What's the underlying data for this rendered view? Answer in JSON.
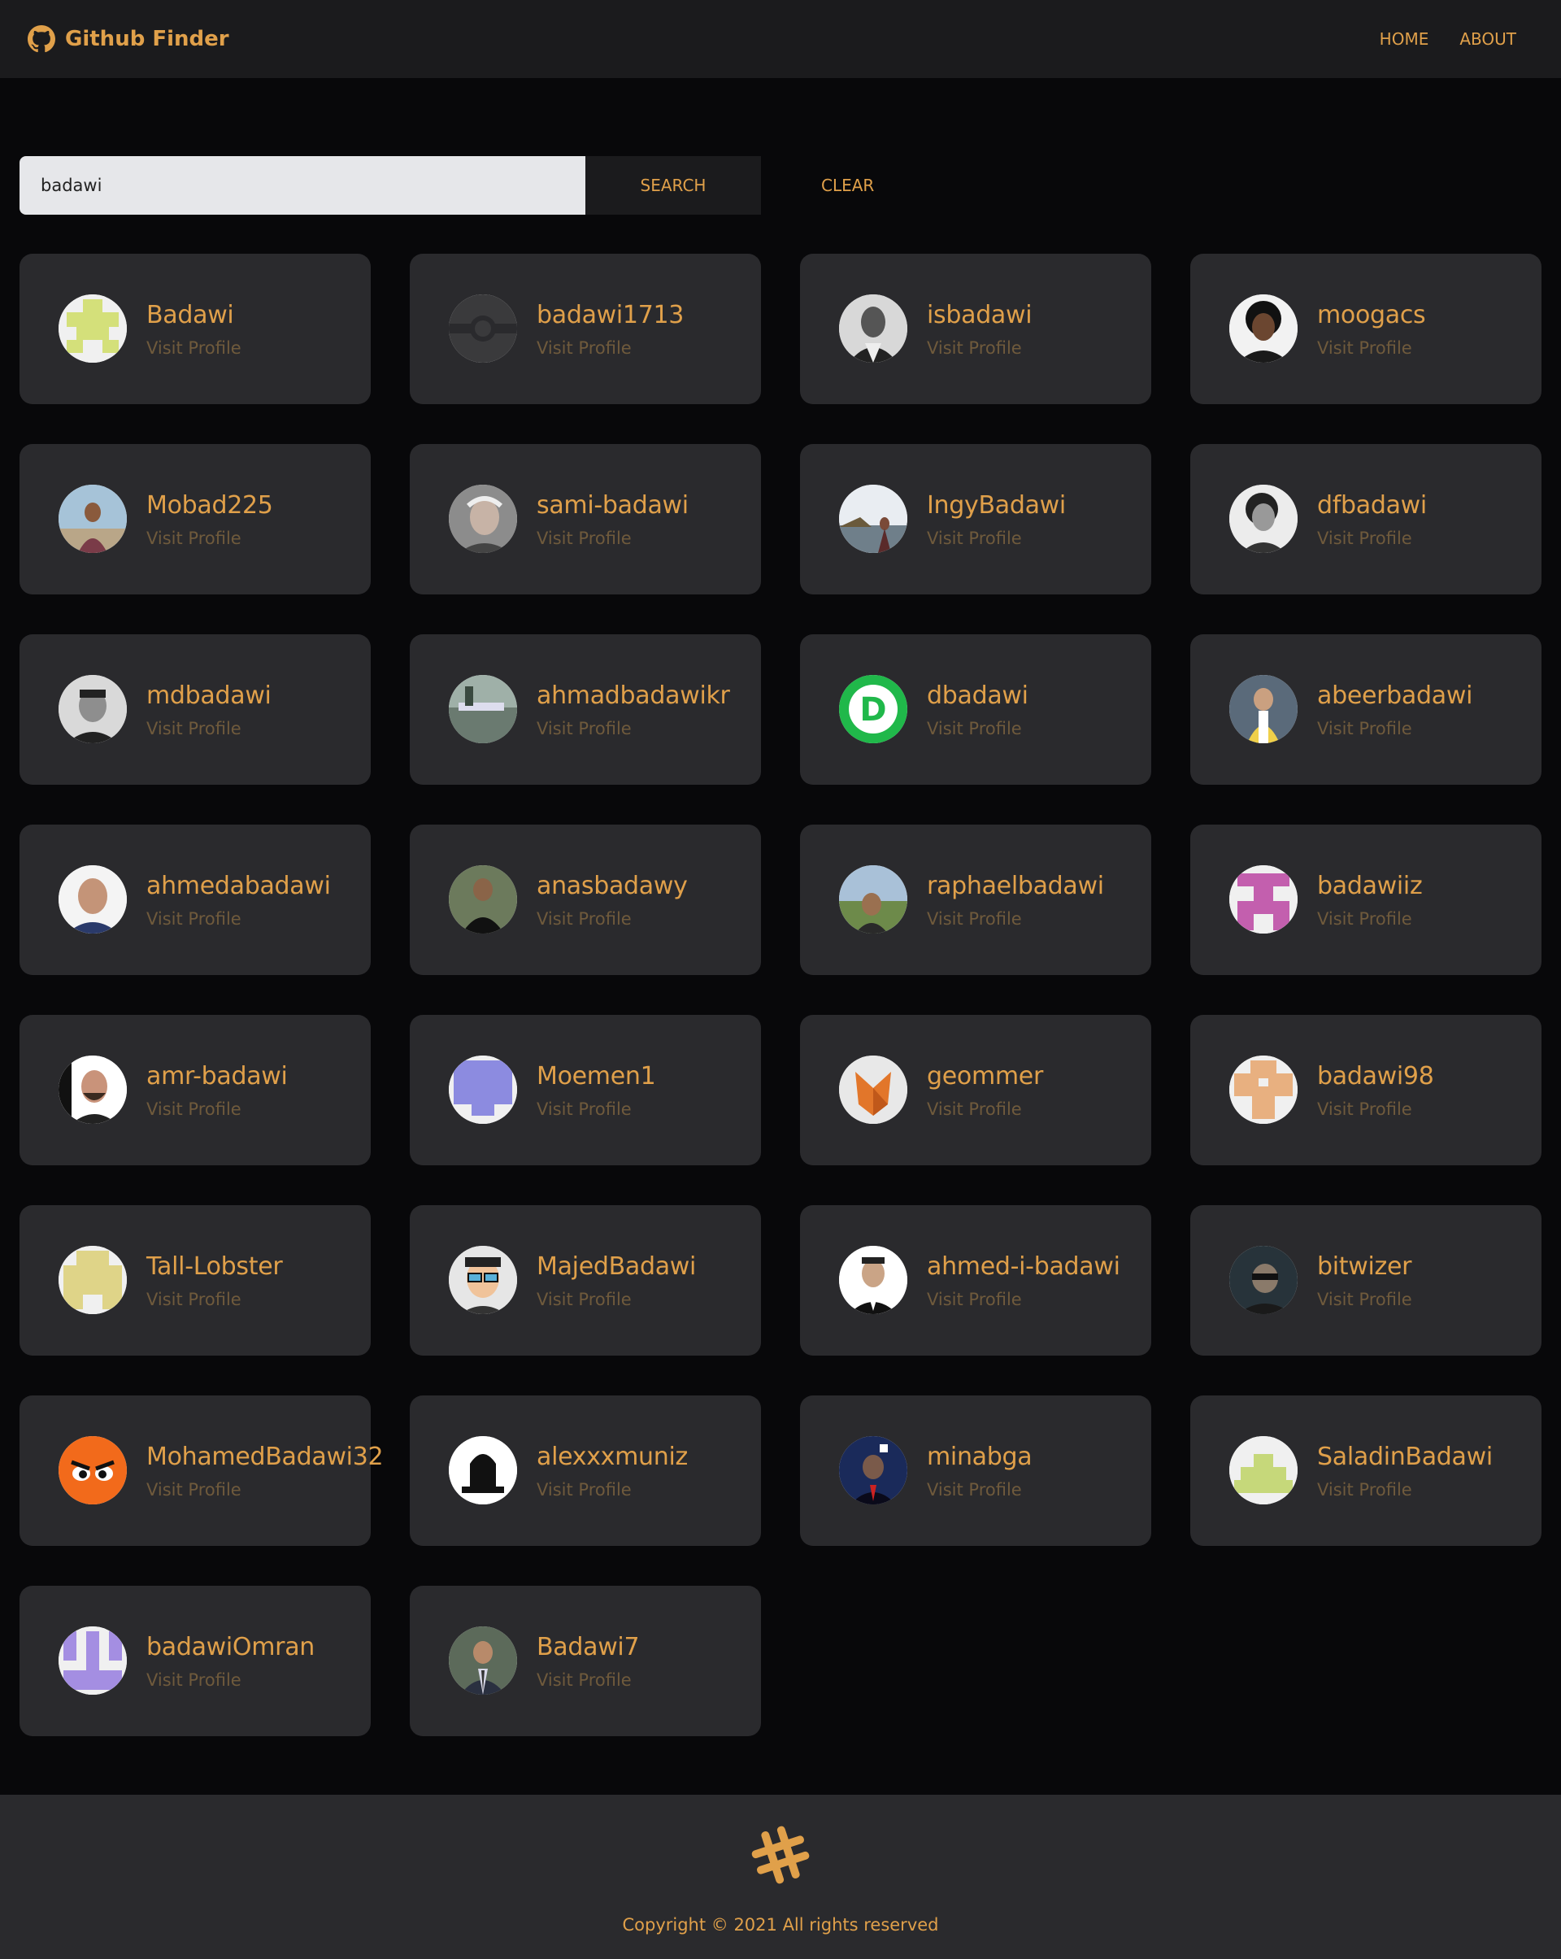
{
  "app": {
    "title": "Github Finder",
    "logo_icon": "github-icon"
  },
  "nav": {
    "home": "HOME",
    "about": "ABOUT"
  },
  "search": {
    "value": "badawi",
    "button": "SEARCH",
    "clear": "CLEAR"
  },
  "users": [
    {
      "name": "Badawi",
      "link": "Visit Profile",
      "avatar": "identicon-green"
    },
    {
      "name": "badawi1713",
      "link": "Visit Profile",
      "avatar": "pokeball-dark"
    },
    {
      "name": "isbadawi",
      "link": "Visit Profile",
      "avatar": "photo-bw"
    },
    {
      "name": "moogacs",
      "link": "Visit Profile",
      "avatar": "photo-curly"
    },
    {
      "name": "Mobad225",
      "link": "Visit Profile",
      "avatar": "photo-outdoor"
    },
    {
      "name": "sami-badawi",
      "link": "Visit Profile",
      "avatar": "photo-gray"
    },
    {
      "name": "IngyBadawi",
      "link": "Visit Profile",
      "avatar": "photo-sea"
    },
    {
      "name": "dfbadawi",
      "link": "Visit Profile",
      "avatar": "photo-bw2"
    },
    {
      "name": "mdbadawi",
      "link": "Visit Profile",
      "avatar": "photo-man"
    },
    {
      "name": "ahmadbadawikr",
      "link": "Visit Profile",
      "avatar": "photo-building"
    },
    {
      "name": "dbadawi",
      "link": "Visit Profile",
      "avatar": "letter-d-green"
    },
    {
      "name": "abeerbadawi",
      "link": "Visit Profile",
      "avatar": "photo-woman"
    },
    {
      "name": "ahmedabadawi",
      "link": "Visit Profile",
      "avatar": "photo-bald"
    },
    {
      "name": "anasbadawy",
      "link": "Visit Profile",
      "avatar": "photo-suit"
    },
    {
      "name": "raphaelbadawi",
      "link": "Visit Profile",
      "avatar": "photo-field"
    },
    {
      "name": "badawiiz",
      "link": "Visit Profile",
      "avatar": "identicon-pink"
    },
    {
      "name": "amr-badawi",
      "link": "Visit Profile",
      "avatar": "photo-beard"
    },
    {
      "name": "Moemen1",
      "link": "Visit Profile",
      "avatar": "identicon-purple"
    },
    {
      "name": "geommer",
      "link": "Visit Profile",
      "avatar": "origami-fox"
    },
    {
      "name": "badawi98",
      "link": "Visit Profile",
      "avatar": "identicon-peach"
    },
    {
      "name": "Tall-Lobster",
      "link": "Visit Profile",
      "avatar": "identicon-yellow"
    },
    {
      "name": "MajedBadawi",
      "link": "Visit Profile",
      "avatar": "cartoon-glasses"
    },
    {
      "name": "ahmed-i-badawi",
      "link": "Visit Profile",
      "avatar": "photo-formal"
    },
    {
      "name": "bitwizer",
      "link": "Visit Profile",
      "avatar": "photo-dark"
    },
    {
      "name": "MohamedBadawi32",
      "link": "Visit Profile",
      "avatar": "angry-face-orange"
    },
    {
      "name": "alexxxmuniz",
      "link": "Visit Profile",
      "avatar": "logo-black"
    },
    {
      "name": "minabga",
      "link": "Visit Profile",
      "avatar": "photo-night"
    },
    {
      "name": "SaladinBadawi",
      "link": "Visit Profile",
      "avatar": "identicon-lime"
    },
    {
      "name": "badawiOmran",
      "link": "Visit Profile",
      "avatar": "identicon-lavender"
    },
    {
      "name": "Badawi7",
      "link": "Visit Profile",
      "avatar": "photo-tie"
    }
  ],
  "footer": {
    "copyright": "Copyright © 2021 All rights reserved",
    "icon": "hashtag-icon"
  },
  "colors": {
    "accent": "#e0a04a",
    "card": "#2a2a2d",
    "bg": "#08080a",
    "navbar": "#1b1b1d"
  }
}
